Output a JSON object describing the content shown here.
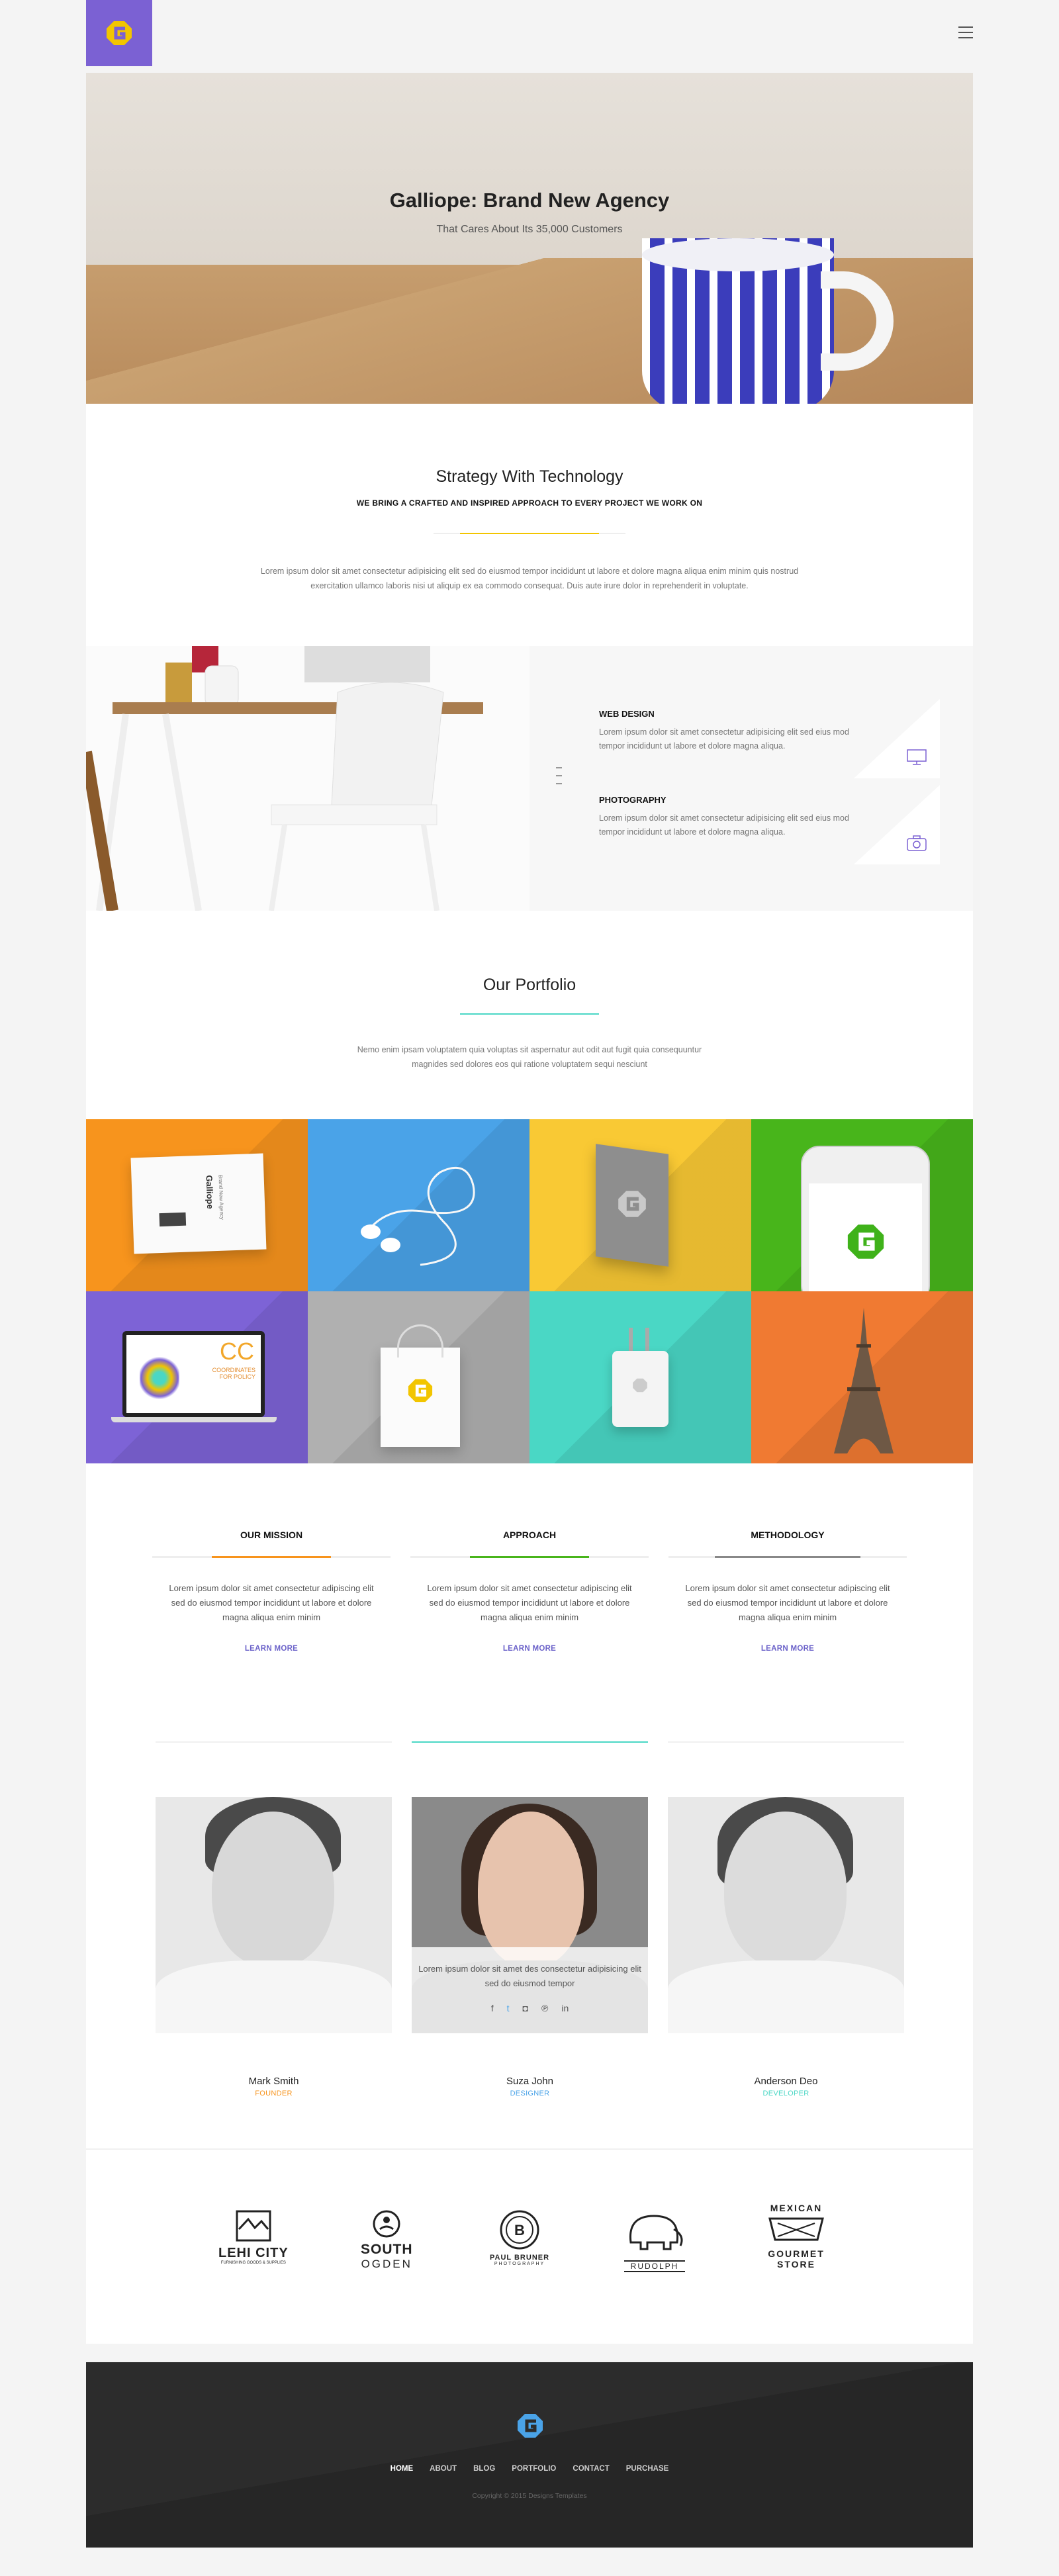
{
  "colors": {
    "accent": "#7b61d3",
    "yellow": "#f2c500",
    "teal": "#4ad7c5",
    "orange": "#f7941d",
    "blue": "#4aa3e8",
    "green": "#48b51b",
    "purple": "#7d63d6",
    "grey": "#b0b0b0"
  },
  "hero": {
    "title": "Galliope: Brand New Agency",
    "subtitle": "That Cares About Its 35,000 Customers"
  },
  "strategy": {
    "title": "Strategy With Technology",
    "tagline": "WE BRING A CRAFTED AND INSPIRED APPROACH TO EVERY PROJECT WE WORK ON",
    "text": "Lorem ipsum dolor sit amet consectetur adipisicing elit sed do eiusmod tempor incididunt ut labore et dolore magna aliqua enim minim quis nostrud exercitation ullamco laboris nisi ut aliquip ex ea commodo consequat. Duis aute irure dolor in reprehenderit in voluptate."
  },
  "services": [
    {
      "title": "WEB DESIGN",
      "text": "Lorem ipsum dolor sit amet consectetur adipisicing elit sed eius mod tempor incididunt ut labore et dolore magna aliqua.",
      "icon": "monitor-icon"
    },
    {
      "title": "PHOTOGRAPHY",
      "text": "Lorem ipsum dolor sit amet consectetur adipisicing elit sed eius mod tempor incididunt ut labore et dolore magna aliqua.",
      "icon": "camera-icon"
    }
  ],
  "portfolio": {
    "title": "Our Portfolio",
    "text": "Nemo enim ipsam voluptatem quia voluptas sit aspernatur aut odit aut fugit quia consequuntur magnides sed dolores eos qui ratione voluptatem sequi nesciunt",
    "card_brand": "Galliope",
    "card_sub": "Brand New Agency",
    "laptop_text": "CC",
    "laptop_small": "COORDINATES FOR POLICY"
  },
  "columns": [
    {
      "title": "OUR MISSION",
      "text": "Lorem ipsum dolor sit amet consectetur adipiscing elit sed do eiusmod tempor incididunt ut labore et dolore magna aliqua enim minim",
      "link": "LEARN MORE",
      "color": "#f7941d"
    },
    {
      "title": "APPROACH",
      "text": "Lorem ipsum dolor sit amet consectetur adipiscing elit sed do eiusmod tempor incididunt ut labore et dolore magna aliqua enim minim",
      "link": "LEARN MORE",
      "color": "#48b51b"
    },
    {
      "title": "METHODOLOGY",
      "text": "Lorem ipsum dolor sit amet consectetur adipiscing elit sed do eiusmod tempor incididunt ut labore et dolore magna aliqua enim minim",
      "link": "LEARN MORE",
      "color": "#888888"
    }
  ],
  "team": [
    {
      "name": "Mark Smith",
      "role": "FOUNDER",
      "color": "#f7941d"
    },
    {
      "name": "Suza John",
      "role": "DESIGNER",
      "color": "#4aa3e8",
      "bio": "Lorem ipsum dolor sit amet des consectetur adipisicing elit sed do eiusmod tempor",
      "social": [
        "f",
        "t",
        "ig",
        "p",
        "in"
      ]
    },
    {
      "name": "Anderson Deo",
      "role": "DEVELOPER",
      "color": "#4ad7c5"
    }
  ],
  "brands": [
    {
      "name": "LEHI CITY",
      "sub": "FURNISHING GOODS & SUPPLIES"
    },
    {
      "name": "SOUTH",
      "sub": "OGDEN"
    },
    {
      "name": "PAUL BRUNER",
      "sub": "PHOTOGRAPHY"
    },
    {
      "name": "RUDOLPH",
      "sub": ""
    },
    {
      "name": "MEXICAN",
      "sub": "GOURMET STORE"
    }
  ],
  "footer": {
    "nav": [
      "HOME",
      "ABOUT",
      "BLOG",
      "PORTFOLIO",
      "CONTACT",
      "PURCHASE"
    ],
    "copyright": "Copyright © 2015 Designs Templates"
  }
}
